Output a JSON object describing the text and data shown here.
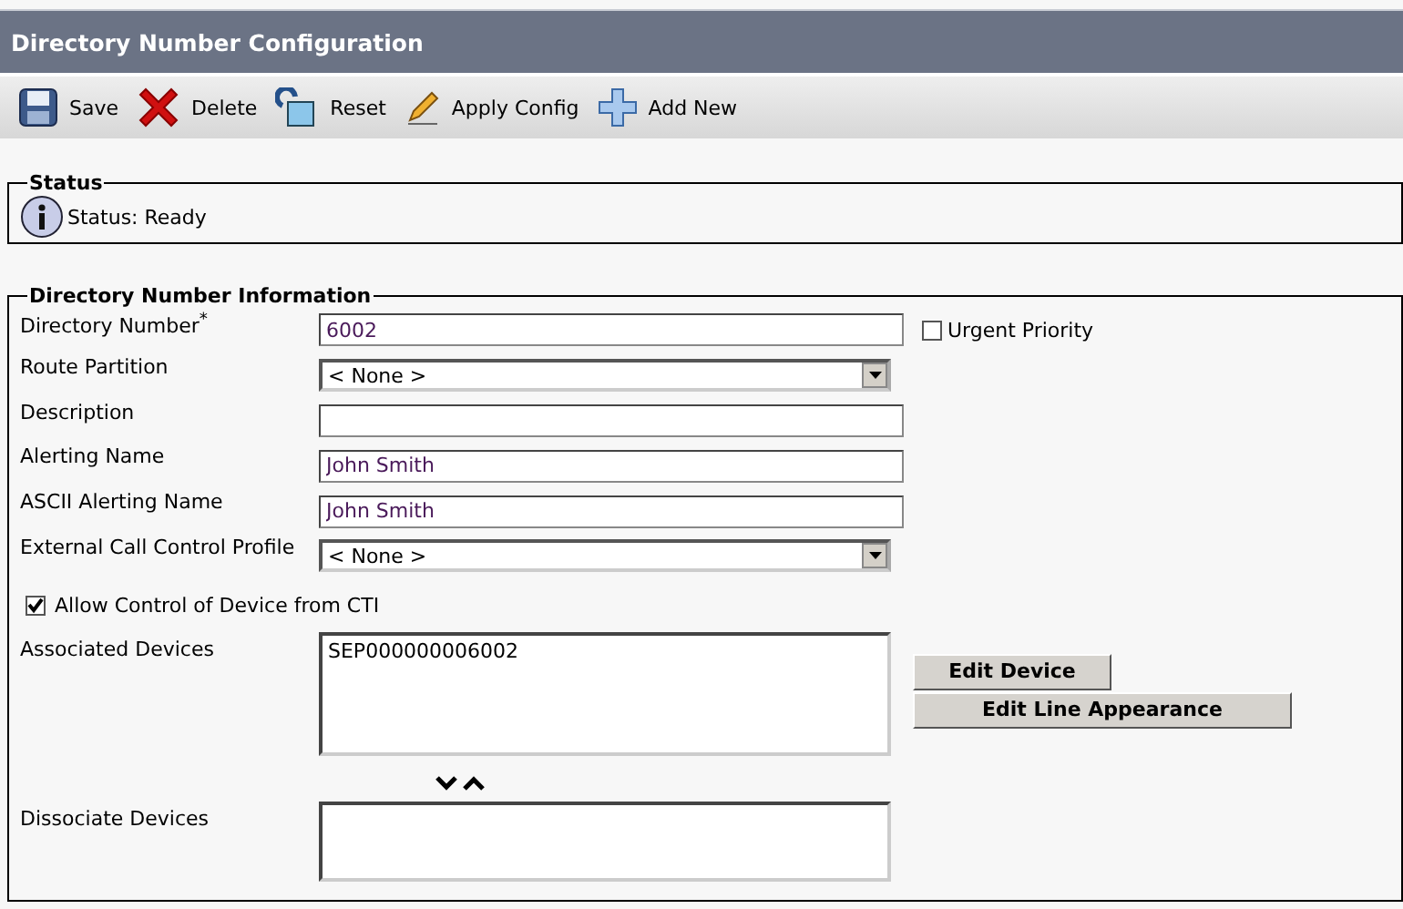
{
  "window": {
    "title": "Directory Number Configuration"
  },
  "toolbar": [
    {
      "kind": "save",
      "label": "Save"
    },
    {
      "kind": "delete",
      "label": "Delete"
    },
    {
      "kind": "reset",
      "label": "Reset"
    },
    {
      "kind": "apply",
      "label": "Apply Config"
    },
    {
      "kind": "add",
      "label": "Add New"
    }
  ],
  "status": {
    "legend": "Status",
    "message": "Status: Ready"
  },
  "dn_info": {
    "legend": "Directory Number Information",
    "fields": [
      {
        "kind": "text",
        "label": "Directory Number$^{*}$",
        "value": "6002",
        "option": {
          "label": "Urgent Priority",
          "checked": false
        }
      },
      {
        "kind": "select",
        "label": "Route Partition",
        "value": "< None >"
      },
      {
        "kind": "text",
        "label": "Description"
      },
      {
        "kind": "text",
        "label": "Alerting Name",
        "value": "John Smith"
      },
      {
        "kind": "text",
        "label": "ASCII Alerting Name",
        "value": "John Smith"
      },
      {
        "kind": "select",
        "label": "External Call Control Profile",
        "value": "< None >"
      }
    ],
    "cti": {
      "label": "Allow Control of Device from CTI",
      "checked": true
    },
    "associated": {
      "label": "Associated Devices",
      "items": [
        "SEP000000006002"
      ]
    },
    "buttons": [
      "Edit Device",
      "Edit Line Appearance"
    ],
    "dissociate": {
      "label": "Dissociate Devices"
    }
  }
}
